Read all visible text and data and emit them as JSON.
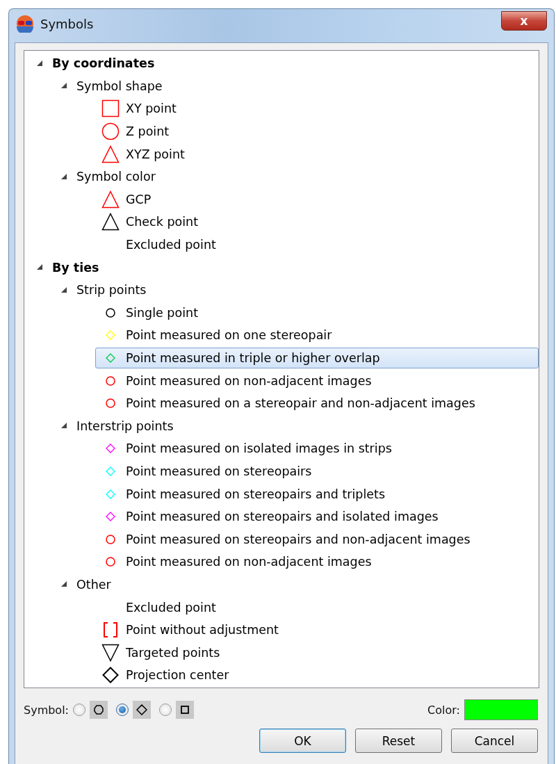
{
  "window": {
    "title": "Symbols",
    "close": "x"
  },
  "tree": [
    {
      "label": "By coordinates",
      "expanded": true,
      "selected": false,
      "children": [
        {
          "label": "Symbol shape",
          "expanded": true,
          "selected": false,
          "children": [
            {
              "label": "XY point",
              "kind": "square",
              "color": "#ff0000",
              "selected": false
            },
            {
              "label": "Z point",
              "kind": "circle",
              "color": "#ff0000",
              "selected": false
            },
            {
              "label": "XYZ point",
              "kind": "triangle",
              "color": "#ff0000",
              "selected": false
            }
          ]
        },
        {
          "label": "Symbol color",
          "expanded": true,
          "selected": false,
          "children": [
            {
              "label": "GCP",
              "kind": "triangle",
              "color": "#ff0000",
              "selected": false
            },
            {
              "label": "Check point",
              "kind": "triangle",
              "color": "#000000",
              "selected": false
            },
            {
              "label": "Excluded point",
              "kind": "none",
              "selected": false
            }
          ]
        }
      ]
    },
    {
      "label": "By ties",
      "expanded": true,
      "selected": false,
      "children": [
        {
          "label": "Strip points",
          "expanded": true,
          "selected": false,
          "children": [
            {
              "label": "Single point",
              "kind": "small-circle",
              "color": "#000000",
              "selected": false
            },
            {
              "label": "Point measured on one stereopair",
              "kind": "small-diamond",
              "color": "#ffff00",
              "selected": false
            },
            {
              "label": "Point measured in triple or higher overlap",
              "kind": "small-diamond",
              "color": "#00cc44",
              "selected": true
            },
            {
              "label": "Point measured on non-adjacent images",
              "kind": "small-circle",
              "color": "#ff0000",
              "selected": false
            },
            {
              "label": "Point measured on a stereopair and non-adjacent images",
              "kind": "small-circle",
              "color": "#ff0000",
              "selected": false
            }
          ]
        },
        {
          "label": "Interstrip points",
          "expanded": true,
          "selected": false,
          "children": [
            {
              "label": "Point measured on isolated images in strips",
              "kind": "small-diamond",
              "color": "#ff00ff",
              "selected": false
            },
            {
              "label": "Point measured on stereopairs",
              "kind": "small-diamond",
              "color": "#00ffff",
              "selected": false
            },
            {
              "label": "Point measured on stereopairs and triplets",
              "kind": "small-diamond",
              "color": "#00ffff",
              "selected": false
            },
            {
              "label": "Point measured on stereopairs and isolated images",
              "kind": "small-diamond",
              "color": "#ff00ff",
              "selected": false
            },
            {
              "label": "Point measured on stereopairs and non-adjacent images",
              "kind": "small-circle",
              "color": "#ff0000",
              "selected": false
            },
            {
              "label": "Point measured on non-adjacent images",
              "kind": "small-circle",
              "color": "#ff0000",
              "selected": false
            }
          ]
        },
        {
          "label": "Other",
          "expanded": true,
          "selected": false,
          "children": [
            {
              "label": "Excluded point",
              "kind": "none",
              "selected": false
            },
            {
              "label": "Point without adjustment",
              "kind": "bracket",
              "color": "#ff0000",
              "selected": false
            },
            {
              "label": "Targeted points",
              "kind": "triangle-down",
              "color": "#000000",
              "selected": false
            },
            {
              "label": "Projection center",
              "kind": "diamond",
              "color": "#000000",
              "selected": false
            }
          ]
        }
      ]
    }
  ],
  "symbol": {
    "label": "Symbol:",
    "options": [
      {
        "kind": "circle",
        "selected": false
      },
      {
        "kind": "diamond",
        "selected": true
      },
      {
        "kind": "square",
        "selected": false
      }
    ]
  },
  "color": {
    "label": "Color:",
    "color": "#00ff00"
  },
  "buttons": [
    {
      "label": "OK",
      "default": true
    },
    {
      "label": "Reset",
      "default": false
    },
    {
      "label": "Cancel",
      "default": false
    }
  ]
}
